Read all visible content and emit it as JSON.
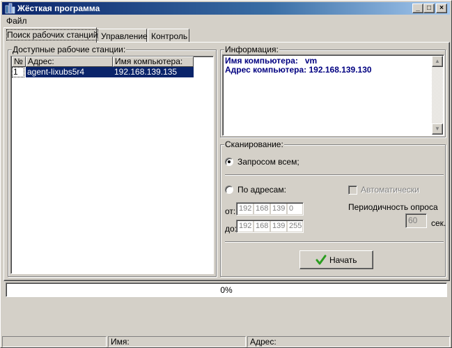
{
  "window": {
    "title": "Жёсткая программа",
    "controls": {
      "minimize": "_",
      "maximize": "□",
      "close": "×"
    }
  },
  "menu": {
    "file": "Файл"
  },
  "tabs": [
    {
      "label": "Поиск рабочих станций",
      "active": true
    },
    {
      "label": "Управление",
      "active": false
    },
    {
      "label": "Контроль",
      "active": false
    }
  ],
  "workstations": {
    "title": "Доступные рабочие станции:",
    "columns": [
      "№",
      "Адрес:",
      "Имя компьютера:"
    ],
    "rows": [
      {
        "num": "1",
        "address": "agent-lixubs5r4",
        "name": "192.168.139.135",
        "selected": true
      }
    ]
  },
  "info": {
    "title": "Информация:",
    "line1": "Имя компьютера:   vm",
    "line2": "Адрес компьютера: 192.168.139.130"
  },
  "scan": {
    "title": "Сканирование:",
    "option_all": "Запросом всем;",
    "option_addr": "По адресам:",
    "auto": "Автоматически",
    "from_label": "от:",
    "to_label": "до:",
    "from_ip": [
      "192",
      "168",
      "139",
      "0"
    ],
    "to_ip": [
      "192",
      "168",
      "139",
      "255"
    ],
    "period_label": "Периодичность опроса",
    "period_value": "60",
    "period_unit": "сек.",
    "start_button": "Начать"
  },
  "progress": {
    "value": 0,
    "text": "0%"
  },
  "status": {
    "name_label": "Имя:",
    "address_label": "Адрес:"
  },
  "colors": {
    "titlebar": "#0a246a",
    "selection": "#0a246a",
    "info_text": "#000080",
    "check_icon": "#2a9d1f"
  }
}
